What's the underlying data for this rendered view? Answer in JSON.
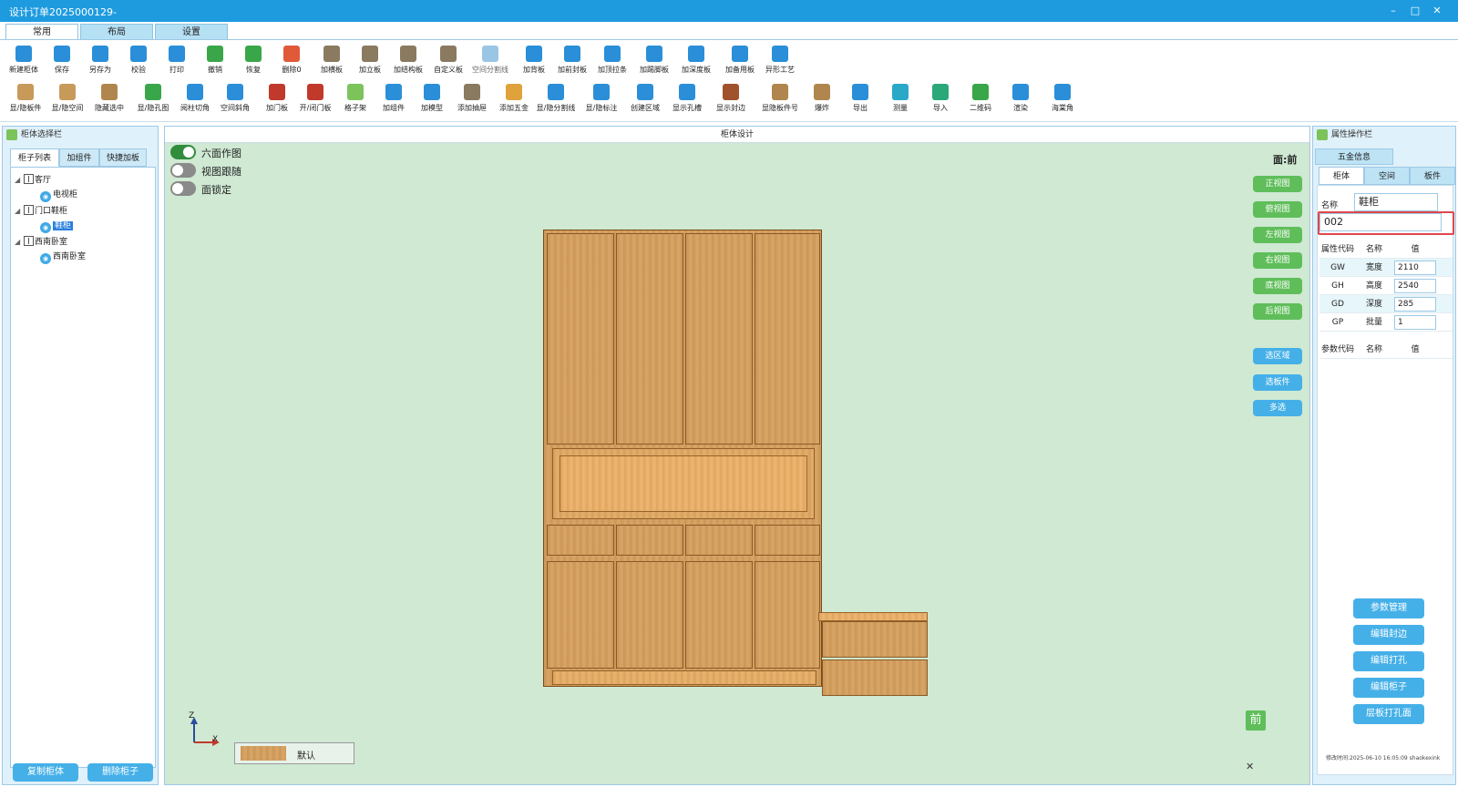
{
  "window": {
    "title": "设计订单2025000129-",
    "controls": [
      "–",
      "□",
      "✕"
    ]
  },
  "ribbon_tabs": [
    {
      "label": "常用",
      "active": true
    },
    {
      "label": "布局",
      "active": false
    },
    {
      "label": "设置",
      "active": false
    }
  ],
  "toolbar_row1": [
    {
      "label": "新建柜体",
      "icon": "new-cabinet-icon",
      "color": "#2a8fd8"
    },
    {
      "label": "保存",
      "icon": "save-icon",
      "color": "#2a8fd8"
    },
    {
      "label": "另存为",
      "icon": "save-as-icon",
      "color": "#2a8fd8"
    },
    {
      "label": "校验",
      "icon": "check-icon",
      "color": "#2a8fd8"
    },
    {
      "label": "打印",
      "icon": "print-icon",
      "color": "#2a8fd8"
    },
    {
      "label": "撤销",
      "icon": "undo-icon",
      "color": "#3aa64a"
    },
    {
      "label": "恢复",
      "icon": "redo-icon",
      "color": "#3aa64a"
    },
    {
      "label": "删除0",
      "icon": "delete-icon",
      "color": "#e05a3a"
    },
    {
      "label": "加横板",
      "icon": "add-h-board-icon",
      "color": "#8a7a60"
    },
    {
      "label": "加立板",
      "icon": "add-v-board-icon",
      "color": "#8a7a60"
    },
    {
      "label": "加结构板",
      "icon": "add-struct-board-icon",
      "color": "#8a7a60"
    },
    {
      "label": "自定义板",
      "icon": "custom-board-icon",
      "color": "#8a7a60"
    },
    {
      "label": "空间分割线",
      "icon": "space-split-icon",
      "color": "#9ac6e6"
    },
    {
      "label": "加背板",
      "icon": "add-back-board-icon",
      "color": "#2a8fd8"
    },
    {
      "label": "加前封板",
      "icon": "add-front-board-icon",
      "color": "#2a8fd8"
    },
    {
      "label": "加顶拉条",
      "icon": "add-top-bar-icon",
      "color": "#2a8fd8"
    },
    {
      "label": "加踢脚板",
      "icon": "add-kick-board-icon",
      "color": "#2a8fd8"
    },
    {
      "label": "加深度板",
      "icon": "add-depth-board-icon",
      "color": "#2a8fd8"
    },
    {
      "label": "加备用板",
      "icon": "add-spare-board-icon",
      "color": "#2a8fd8"
    },
    {
      "label": "异形工艺",
      "icon": "shape-process-icon",
      "color": "#2a8fd8"
    }
  ],
  "toolbar_row2": [
    {
      "label": "显/隐板件",
      "icon": "toggle-board-icon",
      "color": "#c79a5a"
    },
    {
      "label": "显/隐空间",
      "icon": "toggle-space-icon",
      "color": "#c79a5a"
    },
    {
      "label": "隐藏选中",
      "icon": "hide-selected-icon",
      "color": "#b0864e"
    },
    {
      "label": "显/隐孔图",
      "icon": "toggle-hole-icon",
      "color": "#3aa64a"
    },
    {
      "label": "阅柱切角",
      "icon": "pillar-cut-icon",
      "color": "#2a8fd8"
    },
    {
      "label": "空间斜角",
      "icon": "space-bevel-icon",
      "color": "#2a8fd8"
    },
    {
      "label": "加门板",
      "icon": "add-door-icon",
      "color": "#c0392b"
    },
    {
      "label": "开/闭门板",
      "icon": "open-close-door-icon",
      "color": "#c0392b"
    },
    {
      "label": "格子架",
      "icon": "grid-rack-icon",
      "color": "#7cc35c"
    },
    {
      "label": "加组件",
      "icon": "add-component-icon",
      "color": "#2a8fd8"
    },
    {
      "label": "加模型",
      "icon": "add-model-icon",
      "color": "#2a8fd8"
    },
    {
      "label": "添加抽屉",
      "icon": "add-drawer-icon",
      "color": "#8a7a60"
    },
    {
      "label": "添加五金",
      "icon": "add-hardware-icon",
      "color": "#e0a23a"
    },
    {
      "label": "显/隐分割线",
      "icon": "toggle-split-icon",
      "color": "#2a8fd8"
    },
    {
      "label": "显/隐标注",
      "icon": "toggle-annotation-icon",
      "color": "#2a8fd8"
    },
    {
      "label": "创建区域",
      "icon": "create-area-icon",
      "color": "#2a8fd8"
    },
    {
      "label": "显示孔槽",
      "icon": "show-slot-icon",
      "color": "#2a8fd8"
    },
    {
      "label": "显示封边",
      "icon": "show-edge-icon",
      "color": "#a0522d"
    },
    {
      "label": "显隐板件号",
      "icon": "toggle-board-number-icon",
      "color": "#b0864e"
    },
    {
      "label": "爆炸",
      "icon": "explode-icon",
      "color": "#b0864e"
    },
    {
      "label": "导出",
      "icon": "export-icon",
      "color": "#2a8fd8"
    },
    {
      "label": "测量",
      "icon": "measure-icon",
      "color": "#2aa8c8"
    },
    {
      "label": "导入",
      "icon": "import-icon",
      "color": "#2aa87a"
    },
    {
      "label": "二维码",
      "icon": "qrcode-icon",
      "color": "#3aa64a"
    },
    {
      "label": "渲染",
      "icon": "render-icon",
      "color": "#2a8fd8"
    },
    {
      "label": "海棠角",
      "icon": "begonia-corner-icon",
      "color": "#2a8fd8"
    }
  ],
  "left_panel": {
    "title": "柜体选择栏",
    "tabs": [
      "柜子列表",
      "加组件",
      "快捷加板"
    ],
    "tree": [
      {
        "label": "客厅",
        "type": "group",
        "children": [
          {
            "label": "电视柜",
            "selected": false
          }
        ]
      },
      {
        "label": "门口鞋柜",
        "type": "group",
        "children": [
          {
            "label": "鞋柜",
            "selected": true
          }
        ]
      },
      {
        "label": "西南卧室",
        "type": "group",
        "children": [
          {
            "label": "西南卧室",
            "selected": false
          }
        ]
      }
    ],
    "buttons": {
      "copy": "复制柜体",
      "delete": "删除柜子"
    }
  },
  "center": {
    "title": "柜体设计",
    "toggles": [
      {
        "label": "六面作图",
        "on": true
      },
      {
        "label": "视图跟随",
        "on": false
      },
      {
        "label": "面锁定",
        "on": false
      }
    ],
    "face": "面:前",
    "view_buttons": [
      "正视图",
      "俯视图",
      "左视图",
      "右视图",
      "底视图",
      "后视图"
    ],
    "select_buttons": [
      "选区域",
      "选板件",
      "多选"
    ],
    "material": "默认",
    "front_badge": "前",
    "axis_labels": {
      "z": "Z",
      "x": "X"
    }
  },
  "right_panel": {
    "title": "属性操作栏",
    "top_tab": "五金信息",
    "tabs": [
      "柜体",
      "空间",
      "板件"
    ],
    "name_label": "名称",
    "name_value": "鞋柜",
    "code_value": "002",
    "table_headers": [
      "属性代码",
      "名称",
      "值"
    ],
    "properties": [
      {
        "code": "GW",
        "name": "宽度",
        "value": "2110"
      },
      {
        "code": "GH",
        "name": "高度",
        "value": "2540"
      },
      {
        "code": "GD",
        "name": "深度",
        "value": "285"
      },
      {
        "code": "GP",
        "name": "批量",
        "value": "1"
      }
    ],
    "param_headers": [
      "参数代码",
      "名称",
      "值"
    ],
    "buttons": [
      "参数管理",
      "编辑封边",
      "编辑打孔",
      "编辑柜子",
      "层板打孔面"
    ],
    "footer": "修改时间:2025-06-10 16:05:09 shaokexink"
  }
}
